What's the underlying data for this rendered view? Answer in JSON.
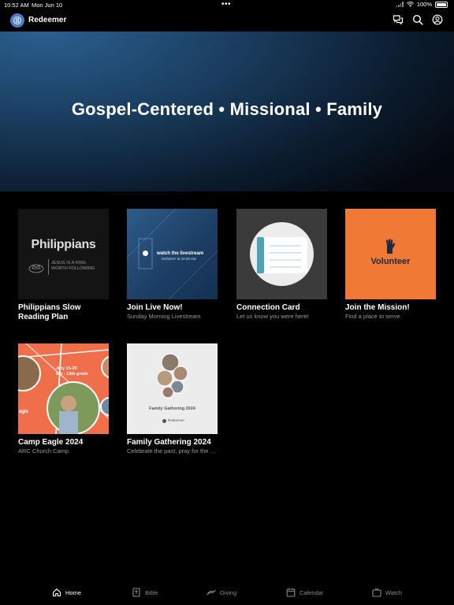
{
  "status": {
    "time": "10:52 AM",
    "date": "Mon Jun 10",
    "dots": "•••",
    "battery": "100%"
  },
  "app": {
    "name": "Redeemer"
  },
  "hero": {
    "title": "Gospel-Centered • Missional • Family"
  },
  "cards": [
    {
      "title": "Philippians Slow Reading Plan",
      "subtitle": "",
      "thumb": {
        "heading": "Philippians",
        "tagline": "JESUS IS A KING WORTH FOLLOWING"
      }
    },
    {
      "title": "Join Live Now!",
      "subtitle": "Sunday Morning Livestream",
      "thumb": {
        "heading": "watch the livestream",
        "tagline": "SUNDAY at 10:30 AM"
      }
    },
    {
      "title": "Connection Card",
      "subtitle": "Let us know you were here!"
    },
    {
      "title": "Join the Mission!",
      "subtitle": "Find a place to serve",
      "thumb": {
        "heading": "Volunteer"
      }
    },
    {
      "title": "Camp Eagle 2024",
      "subtitle": "ARC Church Camp",
      "thumb": {
        "line1": "July 15-20",
        "line2": "6th - 12th grade",
        "side": "agle"
      }
    },
    {
      "title": "Family Gathering 2024",
      "subtitle": "Celebrate the past, pray for the future",
      "thumb": {
        "heading": "Family Gathering 2024",
        "brand": "Redeemer"
      }
    }
  ],
  "tabs": [
    {
      "label": "Home",
      "icon": "home-icon",
      "active": true
    },
    {
      "label": "Bible",
      "icon": "bible-icon",
      "active": false
    },
    {
      "label": "Giving",
      "icon": "giving-icon",
      "active": false
    },
    {
      "label": "Calendar",
      "icon": "calendar-icon",
      "active": false
    },
    {
      "label": "Watch",
      "icon": "tv-icon",
      "active": false
    }
  ],
  "colors": {
    "accent": "#4a7cc7",
    "volunteer": "#f07a35",
    "camp": "#ef6f4a",
    "hero": "#1a3d5f"
  }
}
